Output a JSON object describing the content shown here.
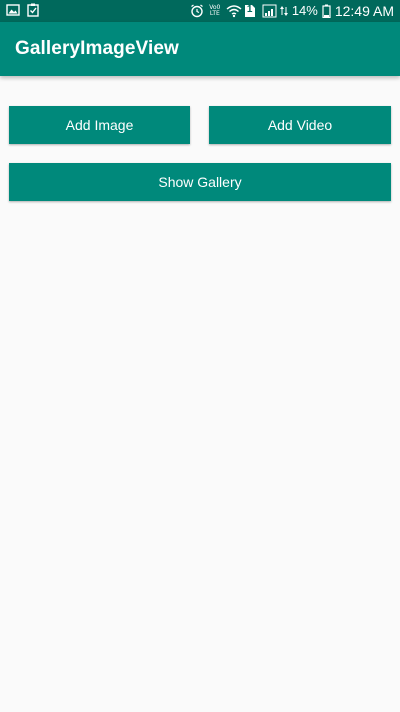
{
  "status_bar": {
    "left_icons": [
      "gallery-notification-icon",
      "checklist-notification-icon"
    ],
    "lte_label": "LTE",
    "vo_label": "Vo0",
    "sim_label": "1",
    "battery_percent": "14%",
    "time": "12:49 AM",
    "right_icons": [
      "alarm-icon",
      "volte-icon",
      "wifi-icon",
      "sim-icon",
      "signal-icon",
      "battery-icon"
    ]
  },
  "app_bar": {
    "title": "GalleryImageView"
  },
  "actions": {
    "add_image_label": "Add Image",
    "add_video_label": "Add Video",
    "show_gallery_label": "Show Gallery"
  },
  "colors": {
    "status_bar": "#00695c",
    "primary": "#00897b",
    "background": "#fafafa",
    "on_primary": "#ffffff"
  }
}
